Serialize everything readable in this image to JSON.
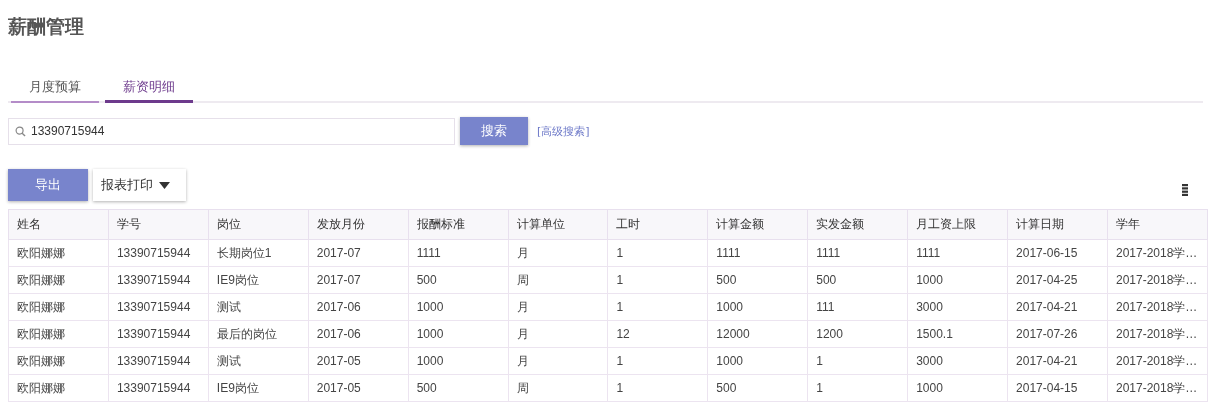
{
  "title": "薪酬管理",
  "tabs": [
    {
      "label": "月度预算",
      "selected": false
    },
    {
      "label": "薪资明细",
      "selected": true
    }
  ],
  "search": {
    "value": "13390715944",
    "button": "搜索",
    "advanced_link": "[高级搜索]"
  },
  "toolbar": {
    "export_button": "导出",
    "print_dropdown": "报表打印"
  },
  "table": {
    "columns": [
      "姓名",
      "学号",
      "岗位",
      "发放月份",
      "报酬标准",
      "计算单位",
      "工时",
      "计算金额",
      "实发金额",
      "月工资上限",
      "计算日期",
      "学年"
    ],
    "rows": [
      [
        "欧阳娜娜",
        "13390715944",
        "长期岗位1",
        "2017-07",
        "1111",
        "月",
        "1",
        "1111",
        "1111",
        "1111",
        "2017-06-15",
        "2017-2018学…"
      ],
      [
        "欧阳娜娜",
        "13390715944",
        "IE9岗位",
        "2017-07",
        "500",
        "周",
        "1",
        "500",
        "500",
        "1000",
        "2017-04-25",
        "2017-2018学…"
      ],
      [
        "欧阳娜娜",
        "13390715944",
        "测试",
        "2017-06",
        "1000",
        "月",
        "1",
        "1000",
        "111",
        "3000",
        "2017-04-21",
        "2017-2018学…"
      ],
      [
        "欧阳娜娜",
        "13390715944",
        "最后的岗位",
        "2017-06",
        "1000",
        "月",
        "12",
        "12000",
        "1200",
        "1500.1",
        "2017-07-26",
        "2017-2018学…"
      ],
      [
        "欧阳娜娜",
        "13390715944",
        "测试",
        "2017-05",
        "1000",
        "月",
        "1",
        "1000",
        "1",
        "3000",
        "2017-04-21",
        "2017-2018学…"
      ],
      [
        "欧阳娜娜",
        "13390715944",
        "IE9岗位",
        "2017-05",
        "500",
        "周",
        "1",
        "500",
        "1",
        "1000",
        "2017-04-15",
        "2017-2018学…"
      ]
    ]
  }
}
